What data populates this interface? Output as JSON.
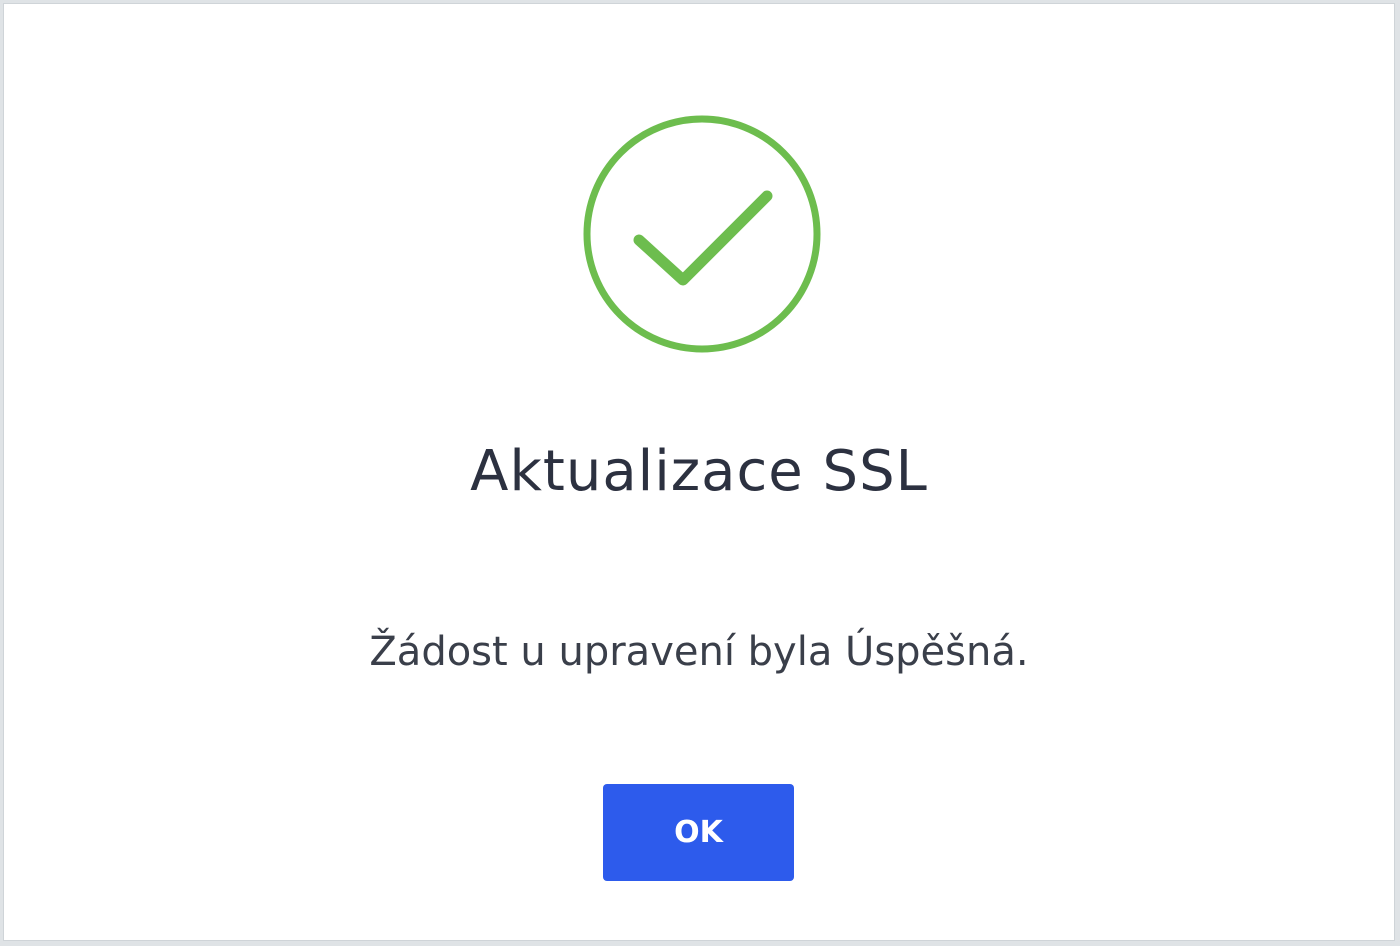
{
  "dialog": {
    "icon": "check-circle-icon",
    "icon_color": "#6dbd4e",
    "title": "Aktualizace SSL",
    "message": "Žádost u upravení byla Úspěšná.",
    "ok_label": "OK",
    "button_color": "#2d5bec"
  }
}
